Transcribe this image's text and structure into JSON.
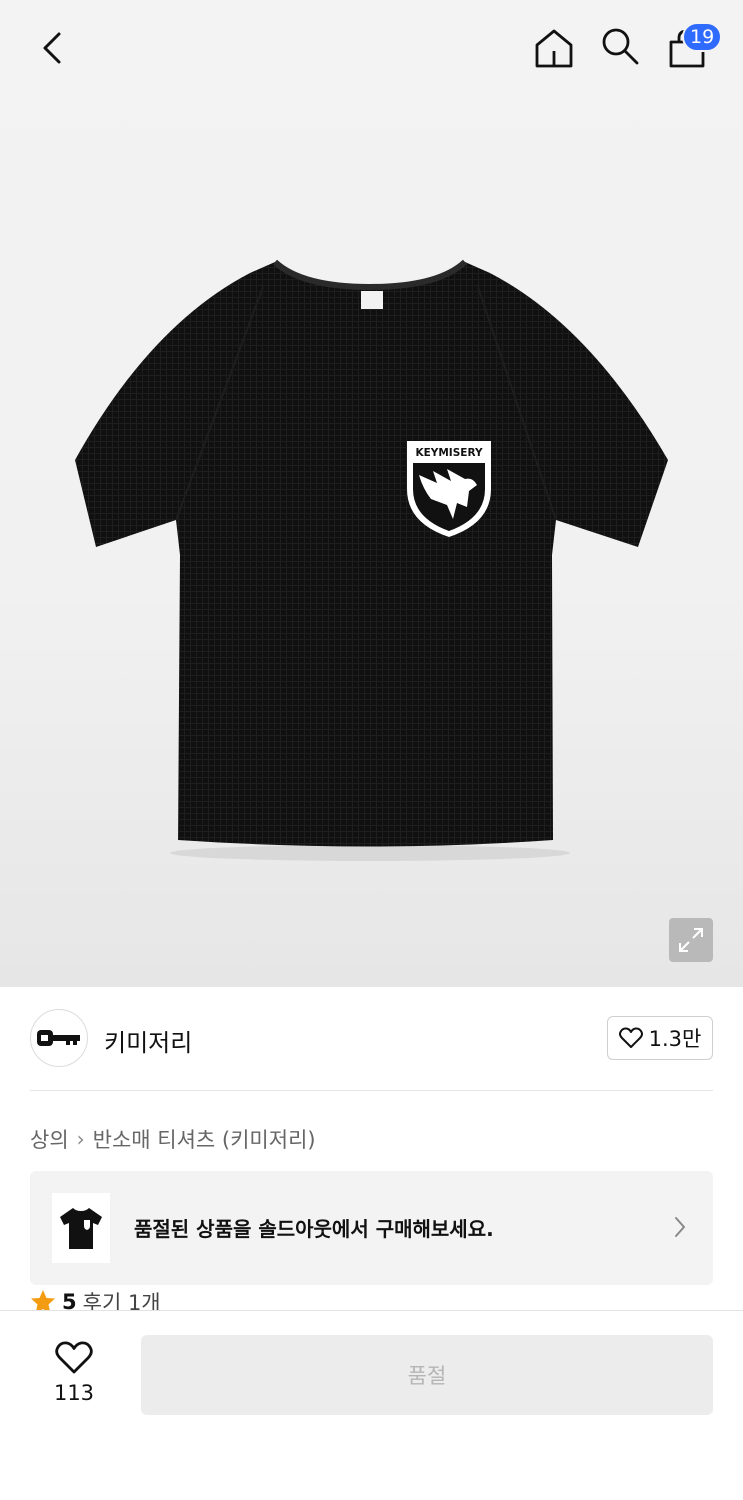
{
  "header": {
    "cart_count": "19",
    "icons": [
      "back-icon",
      "home-icon",
      "search-icon",
      "shopping-bag-icon"
    ]
  },
  "product": {
    "image_icon": "tshirt-image",
    "print_text": "KEYMISERY",
    "expand_icon": "expand-icon"
  },
  "brand": {
    "name": "키미저리",
    "logo_icon": "key-icon",
    "likes": "1.3만"
  },
  "breadcrumb": {
    "category": "상의",
    "subcategory": "반소매 티셔츠 (키미저리)"
  },
  "soldout_banner": {
    "text": "품절된 상품을 솔드아웃에서 구매해보세요."
  },
  "review": {
    "score": "5",
    "count_label": "후기 1개"
  },
  "bottom": {
    "wish_count": "113",
    "buy_label": "품절"
  },
  "colors": {
    "badge": "#2f6bff",
    "star": "#f39c12",
    "disabled_button": "#ececec"
  }
}
